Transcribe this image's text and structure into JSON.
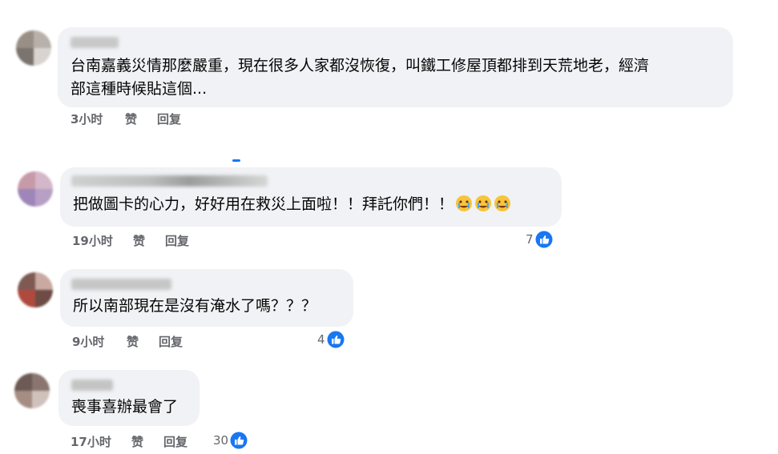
{
  "comments": [
    {
      "text": "台南嘉義災情那麼嚴重，現在很多人家都沒恢復，叫鐵工修屋頂都排到天荒地老，經濟\n部這種時候貼這個...",
      "time": "3小时",
      "like_label": "赞",
      "reply_label": "回复",
      "reaction_count": "",
      "avatar_colors": [
        "#9a8f86",
        "#7b736d",
        "#b8b0aa",
        "#d9d4cf"
      ]
    },
    {
      "text": "把做圖卡的心力，好好用在救災上面啦！！拜託你們！！",
      "time": "19小时",
      "like_label": "赞",
      "reply_label": "回复",
      "reaction_count": "7",
      "avatar_colors": [
        "#c79aa8",
        "#9e86b8",
        "#d4b7c9",
        "#b79fc5"
      ]
    },
    {
      "text": "所以南部現在是沒有淹水了嗎？？？",
      "time": "9小时",
      "like_label": "赞",
      "reply_label": "回复",
      "reaction_count": "4",
      "avatar_colors": [
        "#7e5a52",
        "#b04a3f",
        "#c9a9a1",
        "#6e4b44"
      ]
    },
    {
      "text": "喪事喜辦最會了",
      "time": "17小时",
      "like_label": "赞",
      "reply_label": "回复",
      "reaction_count": "30",
      "avatar_colors": [
        "#6c5a55",
        "#a58d84",
        "#8a7570",
        "#cfc2bd"
      ]
    }
  ],
  "colors": {
    "bubble": "#f0f2f5",
    "meta_text": "#65676b",
    "like_blue": "#1877f2"
  },
  "icons": {
    "like": "thumbs-up-like-icon",
    "crying": "crying-face-emoji-icon"
  }
}
